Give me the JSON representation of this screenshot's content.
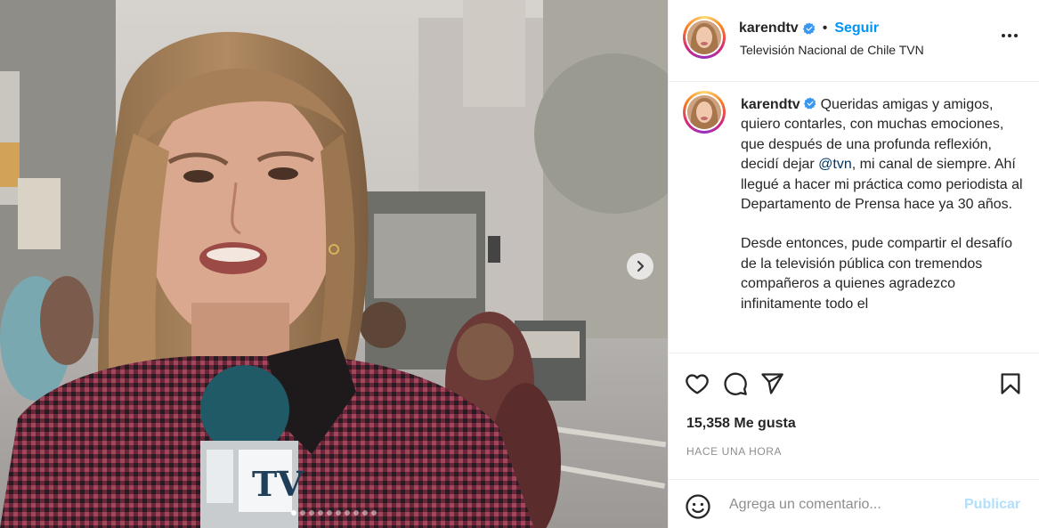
{
  "post": {
    "username": "karendtv",
    "follow_label": "Seguir",
    "separator": "•",
    "location": "Televisión Nacional de Chile TVN",
    "media": {
      "slide_count": 10,
      "active_slide": 1,
      "next_icon": "chevron-right-icon"
    },
    "caption": {
      "username": "karendtv",
      "text_before_mention": "Queridas amigas y amigos, quiero contarles, con muchas emociones, que después de una profunda reflexión, decidí dejar ",
      "mention": "@tvn",
      "text_after_mention": ", mi canal de siempre. Ahí llegué a hacer mi práctica como periodista al Departamento de Prensa hace ya 30 años.",
      "paragraph2": "Desde entonces, pude compartir el desafío de la televisión pública con tremendos compañeros a quienes agradezco infinitamente todo el"
    },
    "likes": "15,358 Me gusta",
    "time": "HACE UNA HORA",
    "comment": {
      "placeholder": "Agrega un comentario...",
      "value": "",
      "publish_label": "Publicar"
    },
    "icons": {
      "like": "heart-icon",
      "comment": "comment-icon",
      "share": "paper-plane-icon",
      "save": "bookmark-icon",
      "emoji": "emoji-icon",
      "more": "more-options-icon",
      "verified": "verified-badge-icon"
    },
    "colors": {
      "accent": "#0095f6",
      "mention": "#00376b",
      "publish_disabled": "#b2dffc",
      "muted": "#8e8e8e"
    }
  }
}
